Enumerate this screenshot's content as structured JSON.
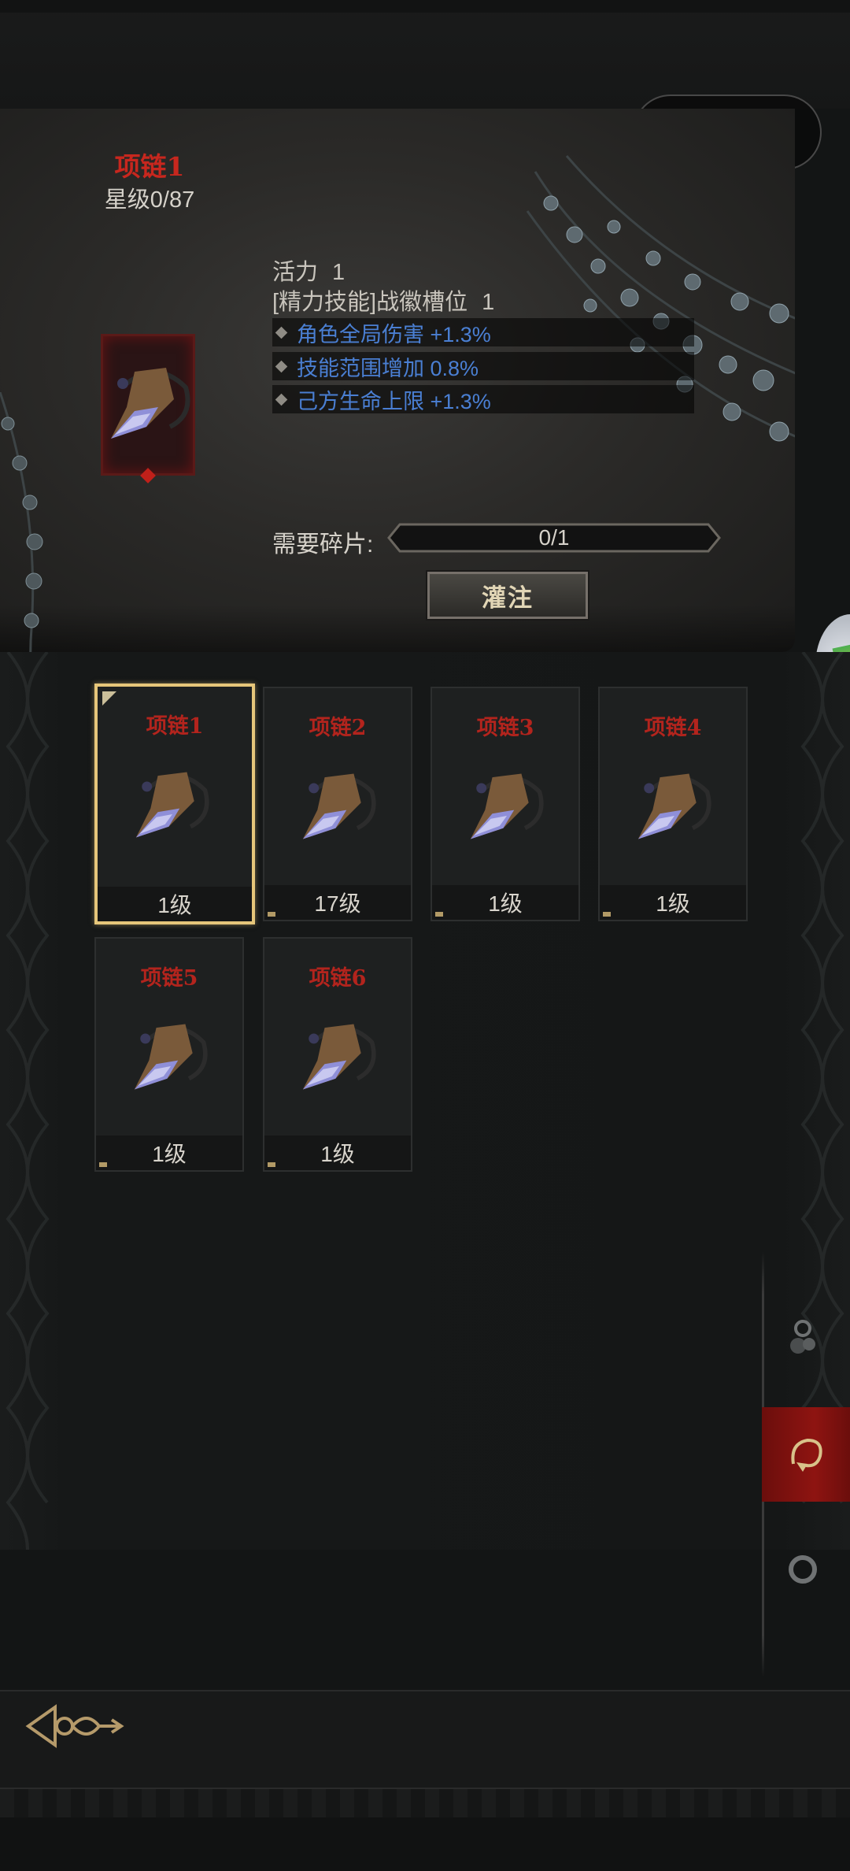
{
  "capsule": {
    "more_icon": "more-dots-icon",
    "close_icon": "target-close-icon"
  },
  "detail": {
    "item_name": "项链1",
    "star_level": "星级0/87",
    "stats": [
      {
        "label": "活力",
        "value": "1"
      },
      {
        "label": "[精力技能]战徽槽位",
        "value": "1"
      }
    ],
    "affixes": [
      "角色全局伤害 +1.3%",
      "技能范围增加 0.8%",
      "己方生命上限 +1.3%"
    ],
    "fragments_label": "需要碎片:",
    "fragments_value": "0/1",
    "infuse_button": "灌注"
  },
  "cards": [
    {
      "name": "项链1",
      "level": "1级",
      "selected": true
    },
    {
      "name": "项链2",
      "level": "17级",
      "selected": false
    },
    {
      "name": "项链3",
      "level": "1级",
      "selected": false
    },
    {
      "name": "项链4",
      "level": "1级",
      "selected": false
    },
    {
      "name": "项链5",
      "level": "1级",
      "selected": false
    },
    {
      "name": "项链6",
      "level": "1级",
      "selected": false
    }
  ],
  "filters": [
    {
      "icon": "earring-icon",
      "active": false
    },
    {
      "icon": "necklace-icon",
      "active": true
    },
    {
      "icon": "ring-icon",
      "active": false
    }
  ],
  "colors": {
    "accent_red": "#c7271e",
    "affix_blue": "#4a7fd3",
    "selected_gold": "#e6c67a",
    "active_filter": "#8e1411"
  },
  "back_icon": "ornate-back-arrow-icon"
}
